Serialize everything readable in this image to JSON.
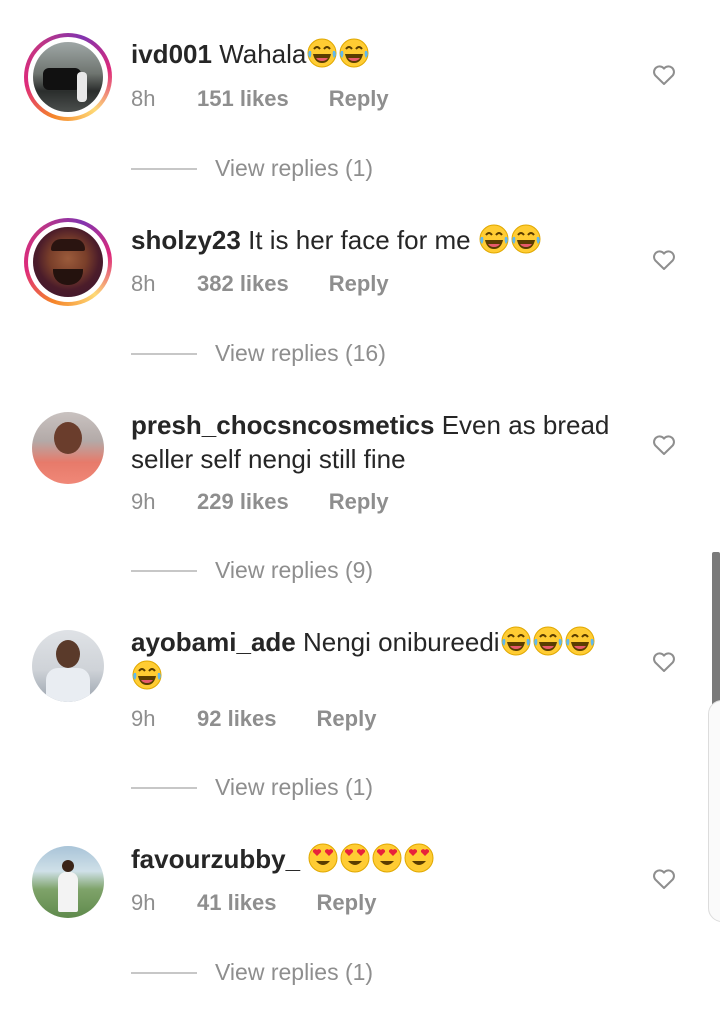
{
  "comments": [
    {
      "username": "ivd001",
      "text": "Wahala",
      "emoji_count": 2,
      "emoji": "laughing-tears-emoji",
      "time": "8h",
      "likes": "151 likes",
      "reply": "Reply",
      "view_replies": "View replies (1)",
      "story_ring": true
    },
    {
      "username": "sholzy23",
      "text": "It is her face for me",
      "emoji_count": 2,
      "emoji": "laughing-tears-emoji",
      "time": "8h",
      "likes": "382 likes",
      "reply": "Reply",
      "view_replies": "View replies (16)",
      "story_ring": true
    },
    {
      "username": "presh_chocsncosmetics",
      "text": "Even as bread seller self nengi still fine",
      "time": "9h",
      "likes": "229 likes",
      "reply": "Reply",
      "view_replies": "View replies (9)",
      "story_ring": false
    },
    {
      "username": "ayobami_ade",
      "text": "Nengi onibureedi",
      "emoji_count": 4,
      "emoji": "laughing-tears-emoji",
      "time": "9h",
      "likes": "92 likes",
      "reply": "Reply",
      "view_replies": "View replies (1)",
      "story_ring": false
    },
    {
      "username": "favourzubby_",
      "text": "",
      "emoji_count": 4,
      "emoji": "heart-eyes-emoji",
      "time": "9h",
      "likes": "41 likes",
      "reply": "Reply",
      "view_replies": "View replies (1)",
      "story_ring": false
    }
  ],
  "icons": {
    "like": "heart-outline-icon"
  },
  "colors": {
    "text": "#262626",
    "muted": "#8e8e8e",
    "divider": "#c7c7c7"
  }
}
